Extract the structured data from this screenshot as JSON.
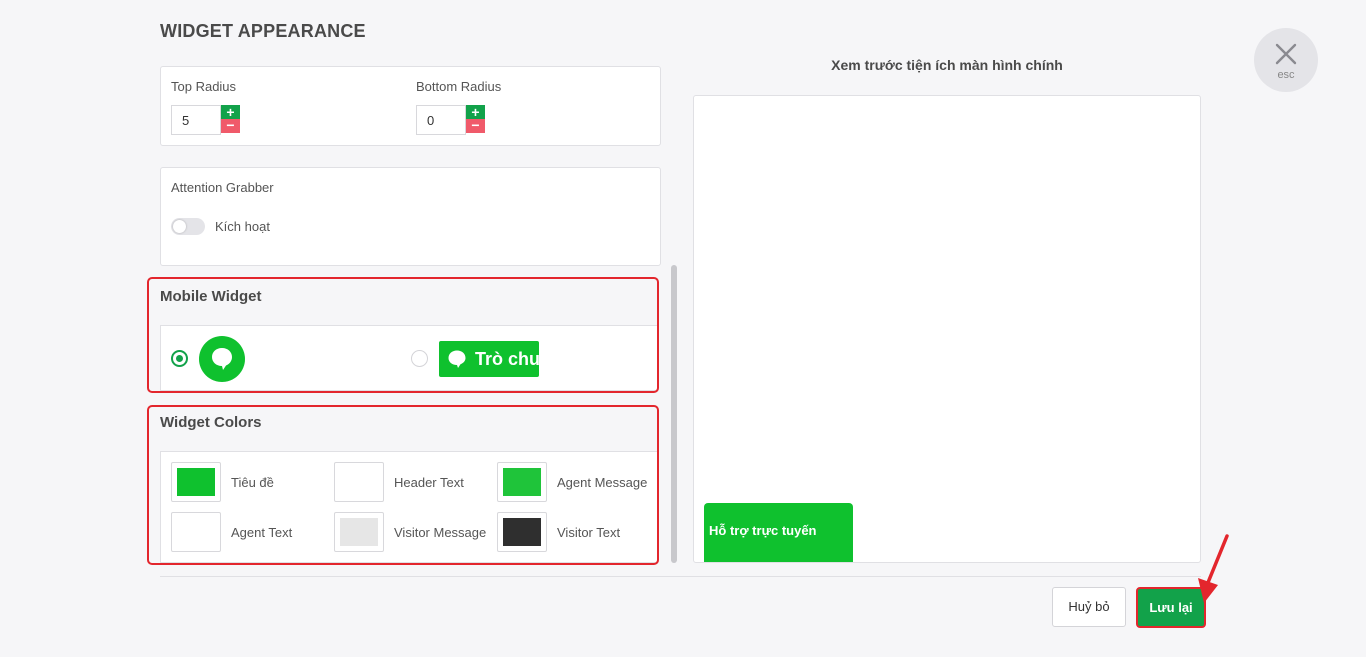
{
  "page": {
    "title": "WIDGET APPEARANCE"
  },
  "radius": {
    "top_label": "Top Radius",
    "top_value": "5",
    "bottom_label": "Bottom Radius",
    "bottom_value": "0",
    "plus_symbol": "+",
    "minus_symbol": "−"
  },
  "attention": {
    "label": "Attention Grabber",
    "toggle_label": "Kích hoạt",
    "toggle_on": false
  },
  "mobile_widget": {
    "title": "Mobile Widget",
    "options": [
      {
        "style": "round-bubble",
        "selected": true
      },
      {
        "style": "rect-bubble",
        "label": "Trò chuyện",
        "selected": false
      }
    ]
  },
  "widget_colors": {
    "title": "Widget Colors",
    "items": [
      {
        "label": "Tiêu đề",
        "color": "#0fc12e"
      },
      {
        "label": "Header Text",
        "color": "#ffffff"
      },
      {
        "label": "Agent Message",
        "color": "#1fc43a"
      },
      {
        "label": "Agent Text",
        "color": "#ffffff"
      },
      {
        "label": "Visitor Message",
        "color": "#e6e6e6"
      },
      {
        "label": "Visitor Text",
        "color": "#2f2f2f"
      }
    ]
  },
  "preview": {
    "title": "Xem trước tiện ích màn hình chính",
    "tab_label": "Hỗ trợ trực tuyến"
  },
  "esc": {
    "label": "esc"
  },
  "actions": {
    "cancel_label": "Huỷ bỏ",
    "save_label": "Lưu lại"
  },
  "colors": {
    "brand_green": "#12a24a",
    "widget_green": "#0fc12e",
    "highlight_red": "#e3262d"
  }
}
